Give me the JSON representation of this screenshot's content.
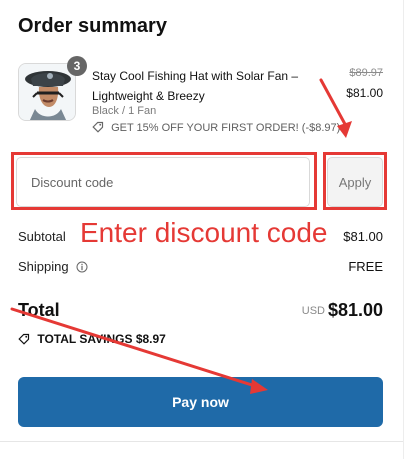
{
  "order_summary": {
    "title": "Order summary",
    "product": {
      "quantity": "3",
      "name": "Stay Cool Fishing Hat with Solar Fan – Lightweight & Breezy",
      "variant": "Black / 1 Fan",
      "promo": "GET 15% OFF YOUR FIRST ORDER!",
      "promo_discount": "(-$8.97)",
      "compare_price": "$89.97",
      "price": "$81.00"
    },
    "discount": {
      "placeholder": "Discount code",
      "apply_label": "Apply"
    },
    "annotation": {
      "text": "Enter discount code"
    },
    "subtotal": {
      "label": "Subtotal",
      "value": "$81.00"
    },
    "shipping": {
      "label": "Shipping",
      "value": "FREE"
    },
    "total": {
      "label": "Total",
      "currency": "USD",
      "value": "$81.00"
    },
    "savings": {
      "label": "TOTAL SAVINGS",
      "value": "$8.97"
    },
    "pay_button": {
      "label": "Pay now"
    }
  },
  "colors": {
    "accent": "#1f6aa8",
    "annotation_red": "#e53935",
    "badge_gray": "#666666"
  },
  "icons": {
    "tag": "tag-icon",
    "info": "info-icon",
    "savings": "savings-tag-icon"
  }
}
